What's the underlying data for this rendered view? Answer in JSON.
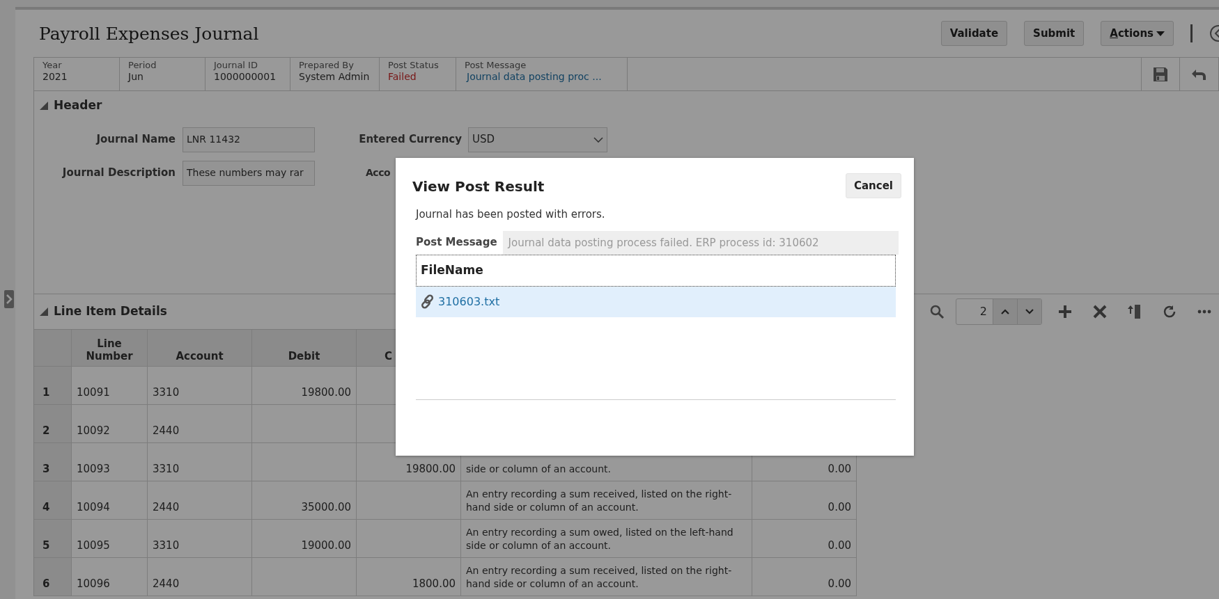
{
  "page": {
    "title": "Payroll Expenses Journal",
    "buttons": [
      {
        "label": "Validate",
        "kind": "plain"
      },
      {
        "label": "Submit",
        "kind": "plain"
      },
      {
        "label": "Actions",
        "kind": "menu"
      }
    ]
  },
  "summary": [
    {
      "label": "Year",
      "value": "2021",
      "kind": "text"
    },
    {
      "label": "Period",
      "value": "Jun",
      "kind": "text"
    },
    {
      "label": "Journal ID",
      "value": "1000000001",
      "kind": "text"
    },
    {
      "label": "Prepared By",
      "value": "System Admin",
      "kind": "text"
    },
    {
      "label": "Post Status",
      "value": "Failed",
      "kind": "status"
    },
    {
      "label": "Post Message",
      "value": "Journal data posting proc ...",
      "kind": "link"
    }
  ],
  "header": {
    "title": "Header",
    "expanded": true,
    "fields": [
      {
        "label": "Journal Name",
        "value": "LNR 11432",
        "kind": "text"
      },
      {
        "label": "Entered Currency",
        "value": "USD",
        "kind": "select"
      },
      {
        "label": "Journal Description",
        "value": "These numbers may rar",
        "kind": "text"
      },
      {
        "label": "Acco",
        "kind": "hidden"
      }
    ]
  },
  "line_items": {
    "title": "Line Item Details",
    "expanded": true,
    "page_value": "2",
    "columns": [
      "",
      "Line Number",
      "Account",
      "Debit",
      "C",
      "",
      ""
    ],
    "rows": [
      {
        "cells": [
          "1",
          "10091",
          "3310",
          "19800.00",
          "",
          "",
          ""
        ]
      },
      {
        "cells": [
          "2",
          "10092",
          "2440",
          "",
          "",
          "",
          ""
        ]
      },
      {
        "cells": [
          "3",
          "10093",
          "3310",
          "",
          "19800.00",
          "side or column of an account.",
          "0.00"
        ]
      },
      {
        "cells": [
          "4",
          "10094",
          "2440",
          "35000.00",
          "",
          "An entry recording a sum received, listed on the right-hand side or column of an account.",
          "0.00"
        ]
      },
      {
        "cells": [
          "5",
          "10095",
          "3310",
          "19000.00",
          "",
          "An entry recording a sum owed, listed on the left-hand side or column of an account.",
          "0.00"
        ]
      },
      {
        "cells": [
          "6",
          "10096",
          "2440",
          "",
          "1800.00",
          "An entry recording a sum received, listed on the right-hand side or column of an account.",
          "0.00"
        ]
      }
    ]
  },
  "dialog": {
    "title": "View Post Result",
    "cancel": "Cancel",
    "message": "Journal has been posted with errors.",
    "post_message_label": "Post Message",
    "post_message": "Journal data posting process failed. ERP process id: 310602",
    "table": {
      "column": "FileName",
      "rows": [
        {
          "file": "310603.txt",
          "selected": true
        }
      ]
    }
  }
}
